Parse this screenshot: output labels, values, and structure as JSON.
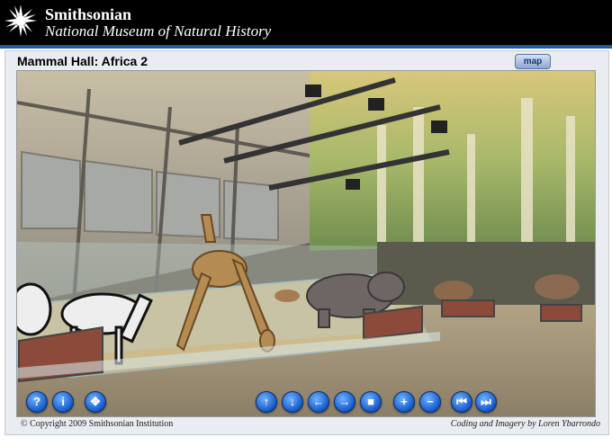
{
  "header": {
    "org_name": "Smithsonian",
    "museum_name": "National Museum of Natural History"
  },
  "panel": {
    "title": "Mammal Hall: Africa 2",
    "map_button": "map"
  },
  "controls": {
    "left": [
      {
        "icon": "help-icon",
        "glyph": "?"
      },
      {
        "icon": "info-icon",
        "glyph": "i"
      },
      {
        "icon": "fullscreen-icon",
        "glyph": "✥"
      }
    ],
    "nav": [
      {
        "icon": "arrow-up-icon",
        "glyph": "↑"
      },
      {
        "icon": "arrow-down-icon",
        "glyph": "↓"
      },
      {
        "icon": "arrow-left-icon",
        "glyph": "←"
      },
      {
        "icon": "arrow-right-icon",
        "glyph": "→"
      },
      {
        "icon": "stop-icon",
        "glyph": "■"
      },
      {
        "icon": "zoom-in-icon",
        "glyph": "+"
      },
      {
        "icon": "zoom-out-icon",
        "glyph": "−"
      },
      {
        "icon": "skip-back-icon",
        "glyph": "⏮"
      },
      {
        "icon": "skip-forward-icon",
        "glyph": "⏭"
      }
    ]
  },
  "footer": {
    "copyright": "© Copyright 2009 Smithsonian Institution",
    "credit": "Coding and Imagery by Loren Ybarrondo"
  },
  "colors": {
    "header_bg": "#000000",
    "accent_blue": "#1d5aa8",
    "button_blue": "#1458c8"
  }
}
